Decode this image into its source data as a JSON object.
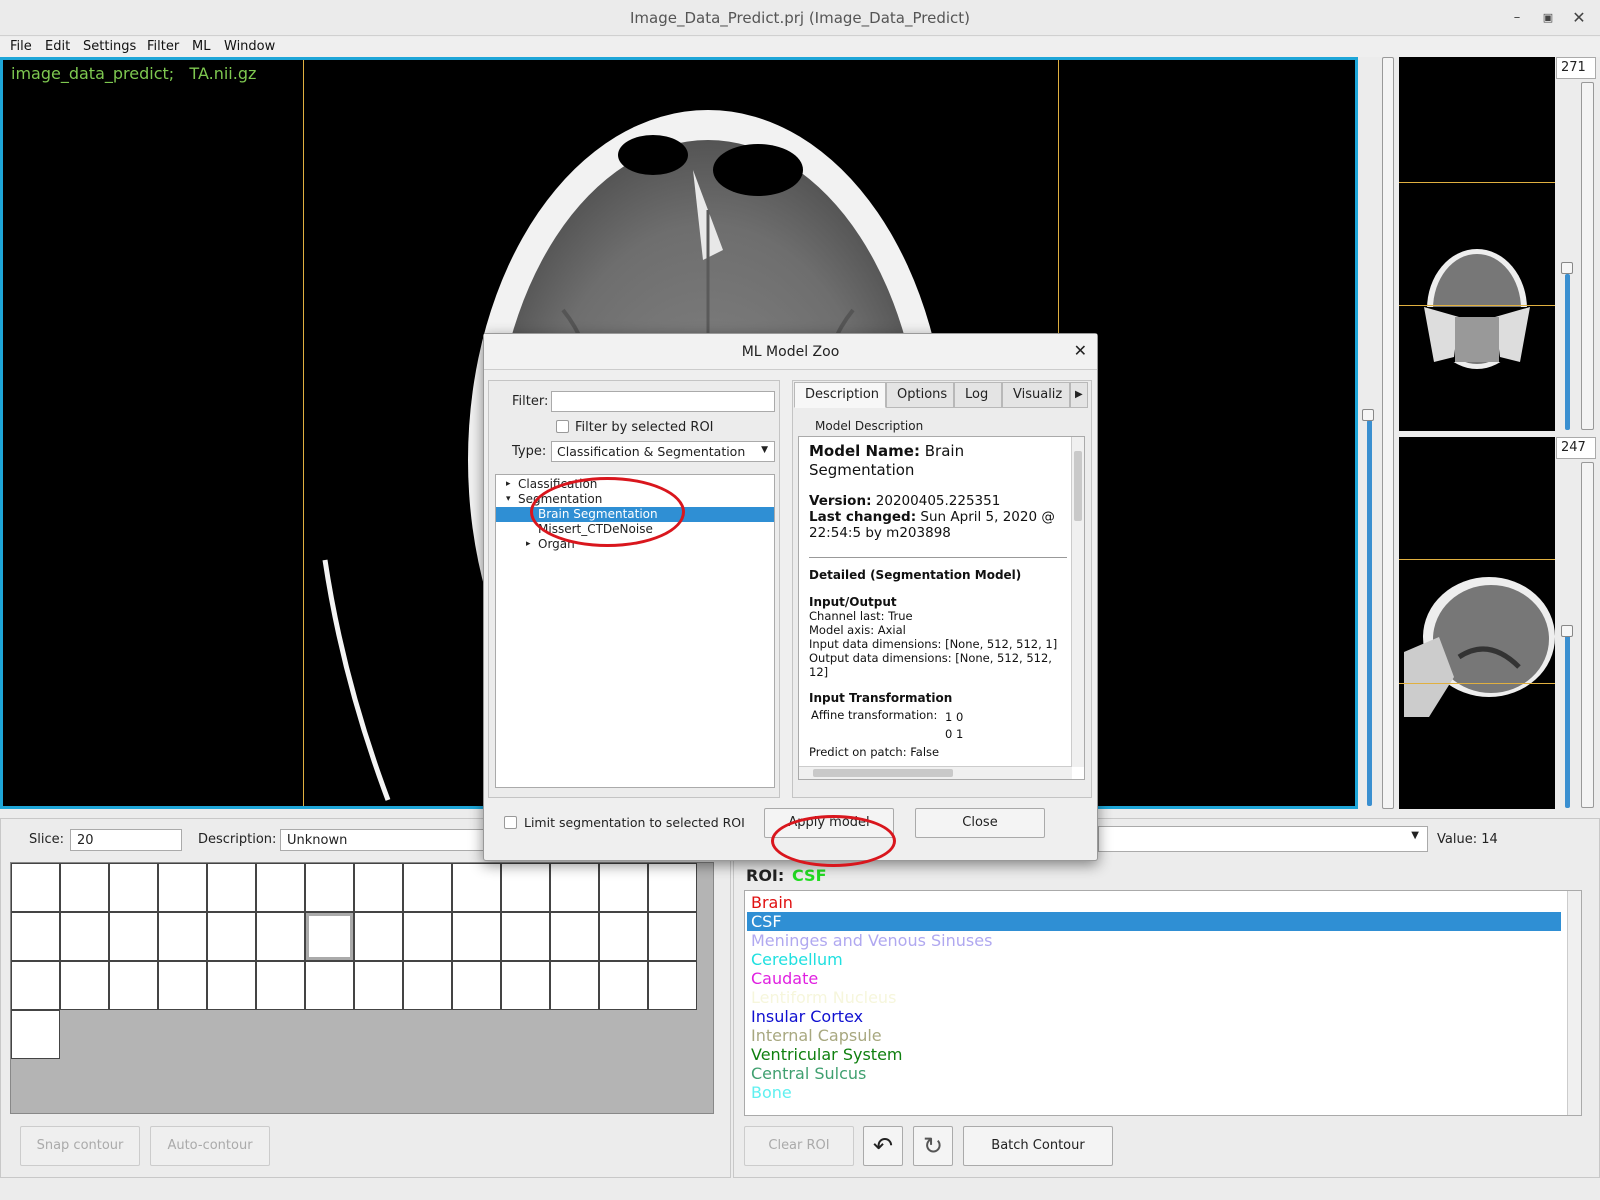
{
  "window": {
    "title": "Image_Data_Predict.prj (Image_Data_Predict)",
    "minimize_icon": "minimize-icon",
    "maximize_icon": "maximize-icon",
    "close_icon": "close-icon"
  },
  "menu": [
    "File",
    "Edit",
    "Settings",
    "Filter",
    "ML",
    "Window"
  ],
  "viewer": {
    "overlay": "image_data_predict;   TA.nii.gz",
    "border_color": "#1ea6d8",
    "crosshair_color": "#e0b040"
  },
  "side": {
    "top_spin": "271",
    "bottom_spin": "247"
  },
  "bottom_left": {
    "slice_label": "Slice:",
    "slice_value": "20",
    "description_label": "Description:",
    "description_value": "Unknown",
    "snap_contour": "Snap contour",
    "auto_contour": "Auto-contour"
  },
  "bottom_right": {
    "value_label": "Value: 14",
    "roi_label": "ROI:",
    "roi_value": "CSF",
    "roi_value_color": "#22dd22",
    "rois": [
      {
        "name": "Brain",
        "color": "#e01010"
      },
      {
        "name": "CSF",
        "color": "#ffffff",
        "selected": true
      },
      {
        "name": "Meninges and Venous Sinuses",
        "color": "#b0a8f0"
      },
      {
        "name": "Cerebellum",
        "color": "#20e0e0"
      },
      {
        "name": "Caudate",
        "color": "#e020e0"
      },
      {
        "name": "Lentiform Nucleus",
        "color": "#f6f6dc"
      },
      {
        "name": "Insular Cortex",
        "color": "#1010d0"
      },
      {
        "name": "Internal Capsule",
        "color": "#a8a880"
      },
      {
        "name": "Ventricular System",
        "color": "#108010"
      },
      {
        "name": "Central Sulcus",
        "color": "#40a070"
      },
      {
        "name": "Bone",
        "color": "#60f0f0"
      }
    ],
    "clear_roi": "Clear ROI",
    "undo_icon": "undo-icon",
    "redo_icon": "redo-icon",
    "batch_contour": "Batch Contour"
  },
  "dialog": {
    "title": "ML Model Zoo",
    "filter_label": "Filter:",
    "filter_value": "",
    "filter_roi_label": "Filter by selected ROI",
    "type_label": "Type:",
    "type_value": "Classification & Segmentation",
    "tree": [
      {
        "label": "Classification",
        "level": 0,
        "expanded": false
      },
      {
        "label": "Segmentation",
        "level": 0,
        "expanded": true
      },
      {
        "label": "Brain Segmentation",
        "level": 1,
        "selected": true
      },
      {
        "label": "Missert_CTDeNoise",
        "level": 1
      },
      {
        "label": "Organ",
        "level": 1,
        "expanded": false
      }
    ],
    "tabs": [
      "Description",
      "Options",
      "Log",
      "Visualiz"
    ],
    "model_description_label": "Model Description",
    "description": {
      "model_name_label": "Model Name:",
      "model_name_1": "Brain",
      "model_name_2": "Segmentation",
      "version_label": "Version:",
      "version_value": "20200405.225351",
      "last_changed_label": "Last changed:",
      "last_changed_1": "Sun April 5, 2020 @",
      "last_changed_2": "22:54:5 by m203898",
      "detailed_heading": "Detailed (Segmentation Model)",
      "io_heading": "Input/Output",
      "channel_last": "Channel last: True",
      "model_axis": "Model axis: Axial",
      "input_dims": "Input data dimensions: [None, 512, 512, 1]",
      "output_dims_1": "Output data dimensions: [None, 512, 512,",
      "output_dims_2": "12]",
      "transform_heading": "Input Transformation",
      "affine_label": "Affine transformation:",
      "affine_row1": "1 0",
      "affine_row2": "0 1",
      "predict_patch": "Predict on patch: False"
    },
    "limit_label": "Limit segmentation to selected ROI",
    "apply_button": "Apply model",
    "close_button": "Close",
    "close_icon": "close-icon"
  }
}
